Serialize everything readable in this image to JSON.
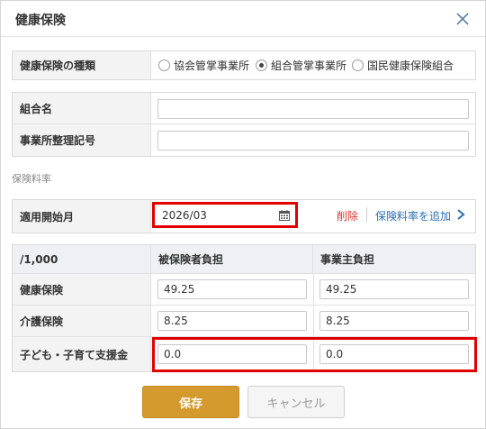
{
  "dialog": {
    "title": "健康保険"
  },
  "insurance_type": {
    "label": "健康保険の種類",
    "options": [
      {
        "label": "協会管掌事業所",
        "checked": false
      },
      {
        "label": "組合管掌事業所",
        "checked": true
      },
      {
        "label": "国民健康保険組合",
        "checked": false
      }
    ]
  },
  "union": {
    "name_label": "組合名",
    "name_value": "",
    "office_code_label": "事業所整理記号",
    "office_code_value": ""
  },
  "rates_caption": "保険料率",
  "start": {
    "label": "適用開始月",
    "value": "2026/03",
    "delete_label": "削除",
    "add_label": "保険料率を追加"
  },
  "rate_table": {
    "headers": [
      "/1,000",
      "被保険者負担",
      "事業主負担"
    ],
    "rows": [
      {
        "label": "健康保険",
        "employee": "49.25",
        "employer": "49.25"
      },
      {
        "label": "介護保険",
        "employee": "8.25",
        "employer": "8.25"
      },
      {
        "label": "子ども・子育て支援金",
        "employee": "0.0",
        "employer": "0.0"
      }
    ]
  },
  "buttons": {
    "save": "保存",
    "cancel": "キャンセル"
  },
  "colors": {
    "primary": "#d49a2d",
    "danger": "#dd3333",
    "link": "#2a6fb6",
    "highlight": "#e00000"
  }
}
